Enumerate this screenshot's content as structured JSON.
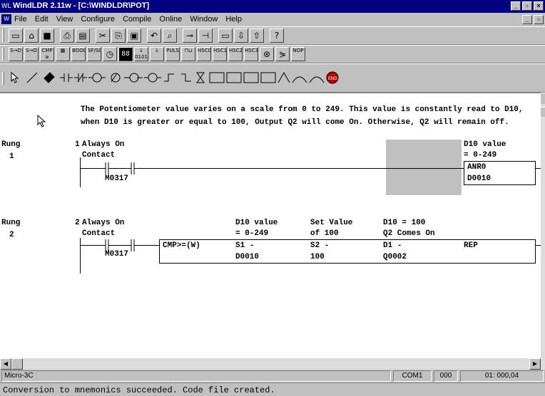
{
  "window": {
    "title": "WindLDR 2.11w - [C:\\WINDLDR\\POT]",
    "app_icon": "WL"
  },
  "menu": [
    "File",
    "Edit",
    "View",
    "Configure",
    "Compile",
    "Online",
    "Window",
    "Help"
  ],
  "toolbar1": [
    "new-icon",
    "open-icon",
    "save-icon",
    "print-icon",
    "print-preview-icon",
    "cut-icon",
    "copy-icon",
    "paste-icon",
    "undo-icon",
    "find-icon",
    "monitor-icon",
    "tag-icon",
    "plc-icon",
    "download-icon",
    "upload-icon",
    "help-icon"
  ],
  "toolbar2": [
    "S→D",
    "S→D",
    "CMP ≥",
    "",
    "BOOL",
    "SF/SO",
    "",
    "",
    "↓ 0101",
    "↓",
    "PULS",
    "",
    "HSC0",
    "HSC1",
    "HSC2",
    "HSC3",
    "",
    "",
    "NOP"
  ],
  "comment": {
    "line1": "The Potentiometer value varies on a scale from 0 to 249. This value is constantly read to D10,",
    "line2": "when D10 is greater or equal to 100, Output Q2 will come On. Otherwise, Q2 will remain off."
  },
  "rung1": {
    "label": "Rung",
    "number": "1",
    "marker": "1",
    "contact_label1": "Always On",
    "contact_label2": "Contact",
    "contact_address": "M0317",
    "out_comment1": "D10 value",
    "out_comment2": "= 0-249",
    "instruction": "ANR0",
    "operand": "D0010"
  },
  "rung2": {
    "label": "Rung",
    "number": "2",
    "marker": "2",
    "contact_label1": "Always On",
    "contact_label2": "Contact",
    "contact_address": "M0317",
    "instruction": "CMP>=(W)",
    "col1_hdr1": "D10 value",
    "col1_hdr2": "= 0-249",
    "col1_label": "S1 -",
    "col1_value": "D0010",
    "col2_hdr1": "Set Value",
    "col2_hdr2": "of 100",
    "col2_label": "S2 -",
    "col2_value": "100",
    "col3_hdr1": "D10 = 100",
    "col3_hdr2": "Q2 Comes On",
    "col3_label": "D1 -",
    "col3_value": "Q0002",
    "col4_label": "REP"
  },
  "status": {
    "plc": "Micro-3C",
    "port": "COM1",
    "station": "000",
    "position": "01: 000,04"
  },
  "message": "Conversion to mnemonics succeeded. Code file created."
}
